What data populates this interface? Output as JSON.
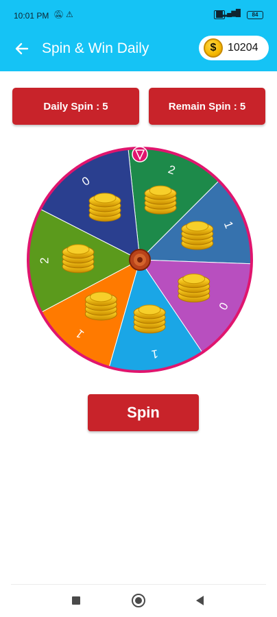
{
  "status_bar": {
    "time": "10:01 PM",
    "icons": [
      "bell-off-icon",
      "warning-icon",
      "sim-icon",
      "signal-icon"
    ],
    "battery": "84"
  },
  "header": {
    "title": "Spin & Win Daily",
    "back_icon": "arrow-left-icon",
    "coin_symbol": "$",
    "coin_balance": "10204",
    "bg_color": "#15c3f5"
  },
  "stats": {
    "daily_spin": "Daily Spin : 5",
    "remain_spin": "Remain Spin : 5"
  },
  "wheel": {
    "pointer_icon": "pointer-icon",
    "rim_color": "#e0156e",
    "segments": [
      {
        "label": "2",
        "color": "#1d8a4a"
      },
      {
        "label": "1",
        "color": "#3672ae"
      },
      {
        "label": "0",
        "color": "#b84fbf"
      },
      {
        "label": "1",
        "color": "#1aa6e6"
      },
      {
        "label": "1",
        "color": "#ff7a00"
      },
      {
        "label": "2",
        "color": "#5b9a1c"
      },
      {
        "label": "0",
        "color": "#2a3f8f"
      }
    ]
  },
  "actions": {
    "spin_label": "Spin",
    "accent": "#c8232a"
  },
  "nav": {
    "recents_icon": "recents-icon",
    "home_icon": "home-icon",
    "back_icon": "nav-back-icon"
  }
}
